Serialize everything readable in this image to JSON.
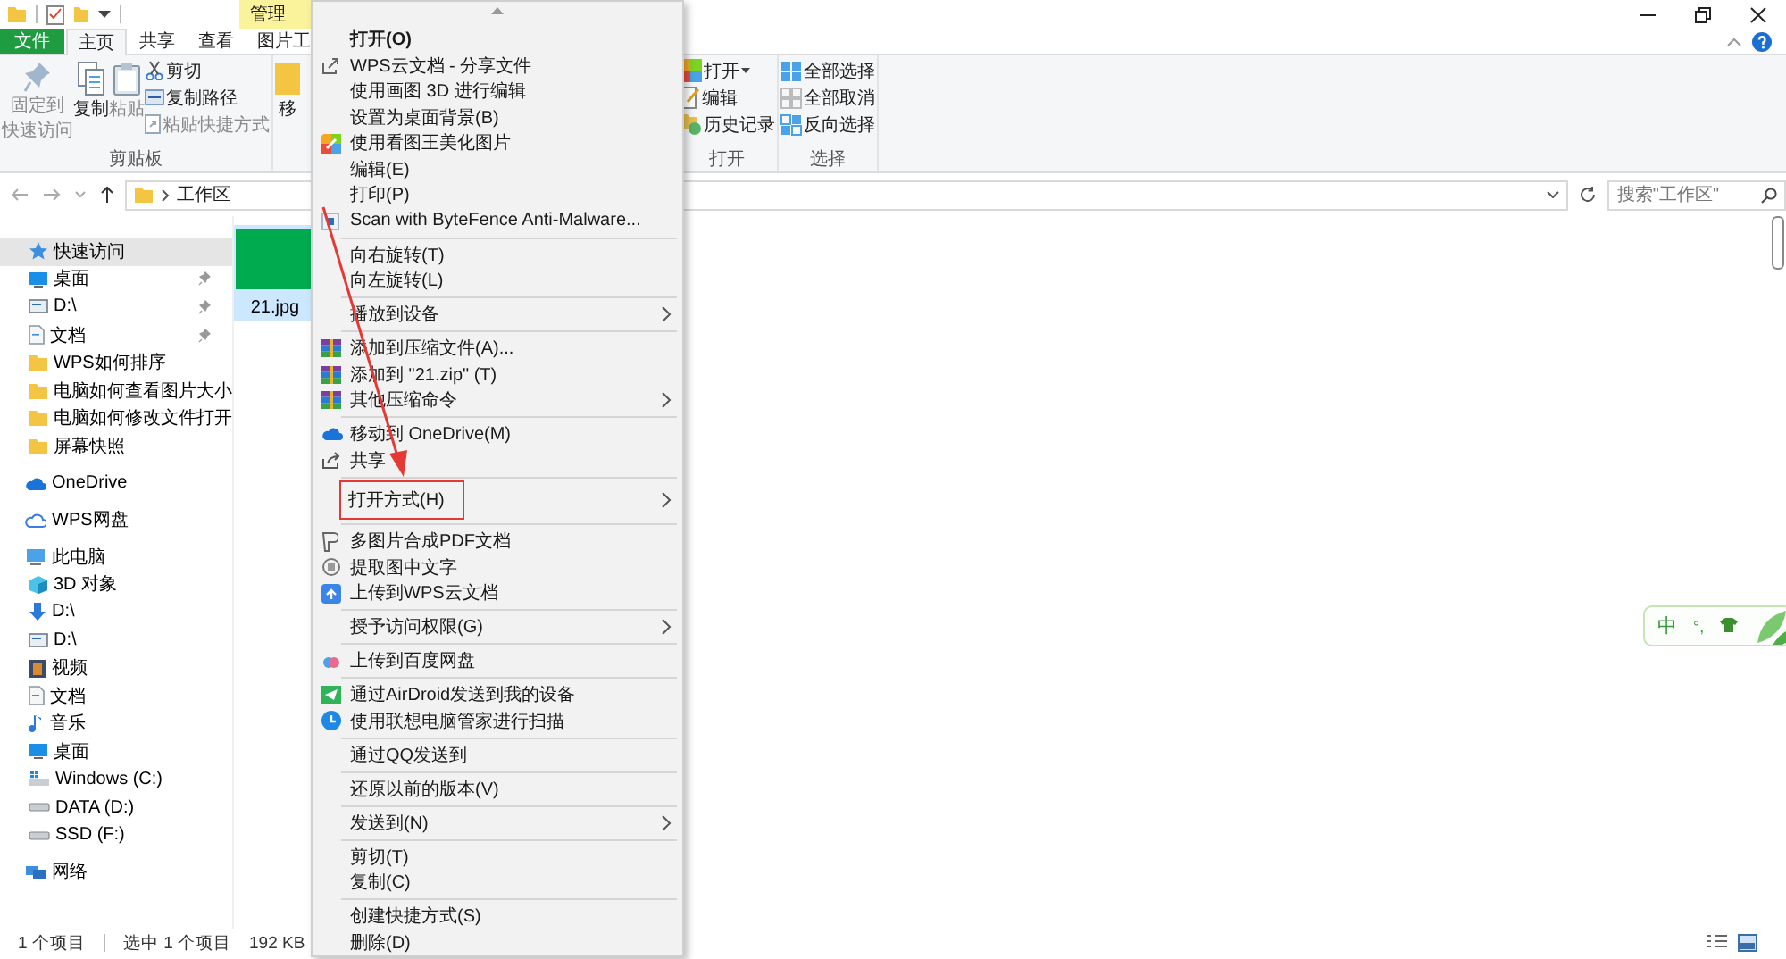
{
  "titlebar": {
    "context_tab": "管理"
  },
  "ribbon_tabs": [
    {
      "label": "文件",
      "kind": "file",
      "selected": false
    },
    {
      "label": "主页",
      "kind": "tab",
      "selected": true
    },
    {
      "label": "共享",
      "kind": "tab",
      "selected": false
    },
    {
      "label": "查看",
      "kind": "tab",
      "selected": false
    },
    {
      "label": "图片工",
      "kind": "tab",
      "selected": false
    }
  ],
  "clipboard": {
    "title": "剪贴板",
    "large_buttons": [
      {
        "label_lines": [
          "固定到",
          "快速访问"
        ],
        "disabled": true
      },
      {
        "label_lines": [
          "复制"
        ],
        "disabled": false
      },
      {
        "label_lines": [
          "粘贴"
        ],
        "disabled": true
      }
    ],
    "small_buttons": [
      {
        "label": "剪切",
        "disabled": false
      },
      {
        "label": "复制路径",
        "disabled": false
      },
      {
        "label": "粘贴快捷方式",
        "disabled": true
      }
    ]
  },
  "move_button": {
    "label": "移"
  },
  "open_group": {
    "title": "打开",
    "items": [
      "打开",
      "编辑",
      "历史记录"
    ]
  },
  "select_group": {
    "title": "选择",
    "items": [
      "全部选择",
      "全部取消",
      "反向选择"
    ]
  },
  "address": {
    "path": "工作区"
  },
  "search": {
    "placeholder": "搜索\"工作区\""
  },
  "sidebar": [
    {
      "label": "快速访问",
      "selected": true,
      "children": [
        {
          "label": "桌面",
          "pinned": true
        },
        {
          "label": "D:\\",
          "pinned": true
        },
        {
          "label": "文档",
          "pinned": true
        },
        {
          "label": "WPS如何排序",
          "pinned": false
        },
        {
          "label": "电脑如何查看图片大小",
          "pinned": false
        },
        {
          "label": "电脑如何修改文件打开",
          "pinned": false
        },
        {
          "label": "屏幕快照",
          "pinned": false
        }
      ]
    },
    {
      "label": "OneDrive",
      "selected": false
    },
    {
      "label": "WPS网盘",
      "selected": false
    },
    {
      "label": "此电脑",
      "selected": false,
      "children": [
        {
          "label": "3D 对象"
        },
        {
          "label": "D:\\"
        },
        {
          "label": "D:\\"
        },
        {
          "label": "视频"
        },
        {
          "label": "文档"
        },
        {
          "label": "音乐"
        },
        {
          "label": "桌面"
        },
        {
          "label": "Windows (C:)"
        },
        {
          "label": "DATA (D:)"
        },
        {
          "label": "SSD (F:)"
        }
      ]
    },
    {
      "label": "网络",
      "selected": false
    }
  ],
  "files": [
    {
      "name": "21.jpg",
      "selected": true
    }
  ],
  "status_bar": {
    "item_count": "1 个项目",
    "selection": "选中 1 个项目",
    "size": "192 KB"
  },
  "ime": {
    "mode": "中",
    "punctuation": "°,"
  },
  "context_menu": [
    {
      "kind": "default",
      "label": "打开(O)",
      "submenu": false
    },
    {
      "kind": "item",
      "label": "WPS云文档 - 分享文件",
      "submenu": false
    },
    {
      "kind": "item",
      "label": "使用画图 3D 进行编辑",
      "submenu": false
    },
    {
      "kind": "item",
      "label": "设置为桌面背景(B)",
      "submenu": false
    },
    {
      "kind": "item",
      "label": "使用看图王美化图片",
      "submenu": false
    },
    {
      "kind": "item",
      "label": "编辑(E)",
      "submenu": false
    },
    {
      "kind": "item",
      "label": "打印(P)",
      "submenu": false
    },
    {
      "kind": "item",
      "label": "Scan with ByteFence Anti-Malware...",
      "submenu": false
    },
    {
      "kind": "separator"
    },
    {
      "kind": "item",
      "label": "向右旋转(T)",
      "submenu": false
    },
    {
      "kind": "item",
      "label": "向左旋转(L)",
      "submenu": false
    },
    {
      "kind": "separator"
    },
    {
      "kind": "item",
      "label": "播放到设备",
      "submenu": true
    },
    {
      "kind": "separator"
    },
    {
      "kind": "item",
      "label": "添加到压缩文件(A)...",
      "submenu": false
    },
    {
      "kind": "item",
      "label": "添加到 \"21.zip\" (T)",
      "submenu": false
    },
    {
      "kind": "item",
      "label": "其他压缩命令",
      "submenu": true
    },
    {
      "kind": "separator"
    },
    {
      "kind": "item",
      "label": "移动到 OneDrive(M)",
      "submenu": false
    },
    {
      "kind": "item",
      "label": "共享",
      "submenu": false
    },
    {
      "kind": "separator"
    },
    {
      "kind": "boxed",
      "label": "打开方式(H)",
      "submenu": true
    },
    {
      "kind": "separator"
    },
    {
      "kind": "item",
      "label": "多图片合成PDF文档",
      "submenu": false
    },
    {
      "kind": "item",
      "label": "提取图中文字",
      "submenu": false
    },
    {
      "kind": "item",
      "label": "上传到WPS云文档",
      "submenu": false
    },
    {
      "kind": "separator"
    },
    {
      "kind": "item",
      "label": "授予访问权限(G)",
      "submenu": true
    },
    {
      "kind": "separator"
    },
    {
      "kind": "item",
      "label": "上传到百度网盘",
      "submenu": false
    },
    {
      "kind": "separator"
    },
    {
      "kind": "item",
      "label": "通过AirDroid发送到我的设备",
      "submenu": false
    },
    {
      "kind": "item",
      "label": "使用联想电脑管家进行扫描",
      "submenu": false
    },
    {
      "kind": "separator"
    },
    {
      "kind": "item",
      "label": "通过QQ发送到",
      "submenu": false
    },
    {
      "kind": "separator"
    },
    {
      "kind": "item",
      "label": "还原以前的版本(V)",
      "submenu": false
    },
    {
      "kind": "separator"
    },
    {
      "kind": "item",
      "label": "发送到(N)",
      "submenu": true
    },
    {
      "kind": "separator"
    },
    {
      "kind": "item",
      "label": "剪切(T)",
      "submenu": false
    },
    {
      "kind": "item",
      "label": "复制(C)",
      "submenu": false
    },
    {
      "kind": "separator"
    },
    {
      "kind": "item",
      "label": "创建快捷方式(S)",
      "submenu": false
    },
    {
      "kind": "item",
      "label": "删除(D)",
      "submenu": false
    }
  ]
}
